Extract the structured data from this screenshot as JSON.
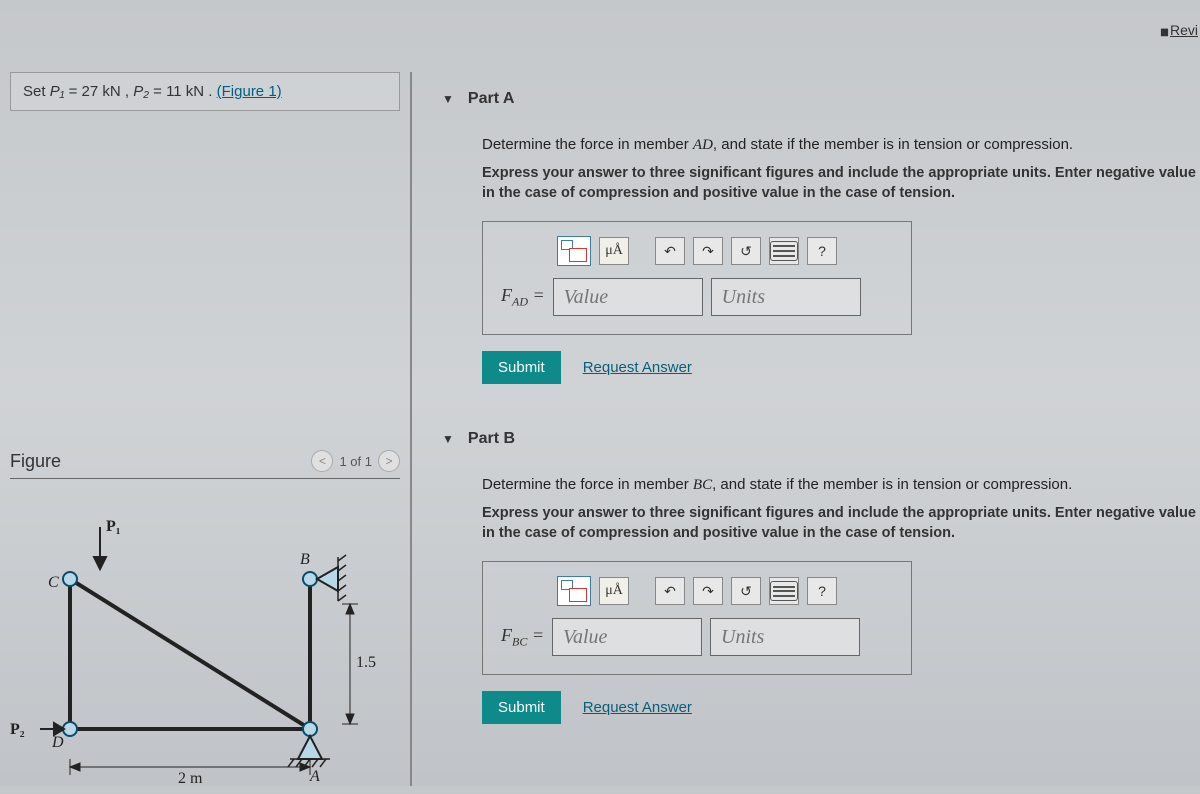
{
  "top_link": "Revi",
  "problem": {
    "prefix": "Set ",
    "p1_var": "P₁",
    "eq1": " = 27 kN , ",
    "p2_var": "P₂",
    "eq2": " = 11 kN . ",
    "figure_link": "(Figure 1)"
  },
  "figure": {
    "title": "Figure",
    "pager": "1 of 1",
    "labels": {
      "P1": "P₁",
      "P2": "P₂",
      "B": "B",
      "C": "C",
      "D": "D",
      "A": "A",
      "w": "2 m",
      "h": "1.5 m"
    }
  },
  "parts": [
    {
      "header": "Part A",
      "question_pre": "Determine the force in member ",
      "member": "AD",
      "question_post": ", and state if the member is in tension or compression.",
      "instruction": "Express your answer to three significant figures and include the appropriate units. Enter negative value in the case of compression and positive value in the case of tension.",
      "var_label_main": "F",
      "var_label_sub": "AD",
      "value_ph": "Value",
      "units_ph": "Units",
      "submit": "Submit",
      "request": "Request Answer",
      "units_btn": "μÅ",
      "help_btn": "?"
    },
    {
      "header": "Part B",
      "question_pre": "Determine the force in member ",
      "member": "BC",
      "question_post": ", and state if the member is in tension or compression.",
      "instruction": "Express your answer to three significant figures and include the appropriate units. Enter negative value in the case of compression and positive value in the case of tension.",
      "var_label_main": "F",
      "var_label_sub": "BC",
      "value_ph": "Value",
      "units_ph": "Units",
      "submit": "Submit",
      "request": "Request Answer",
      "units_btn": "μÅ",
      "help_btn": "?"
    }
  ]
}
